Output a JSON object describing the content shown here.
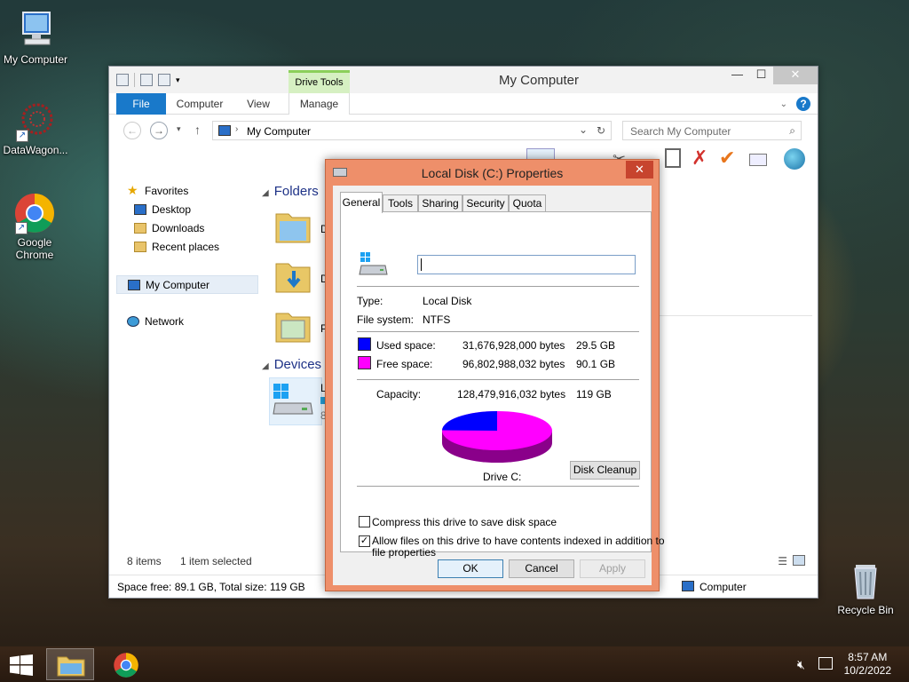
{
  "desktop": {
    "icons": [
      {
        "label": "My Computer"
      },
      {
        "label": "DataWagon..."
      },
      {
        "label": "Google Chrome"
      },
      {
        "label": "Recycle Bin"
      }
    ]
  },
  "explorer": {
    "title": "My Computer",
    "contextual_tab_group": "Drive Tools",
    "tabs": {
      "file": "File",
      "computer": "Computer",
      "view": "View",
      "manage": "Manage"
    },
    "address": "My Computer",
    "search_placeholder": "Search My Computer",
    "nav": {
      "favorites": "Favorites",
      "desktop": "Desktop",
      "downloads": "Downloads",
      "recent": "Recent places",
      "my_computer": "My Computer",
      "network": "Network"
    },
    "groups": {
      "folders": "Folders",
      "devices": "Devices"
    },
    "partial_labels": {
      "folder1": "D",
      "folder2": "D",
      "folder3": "P",
      "device1": "L",
      "device_sub": "8"
    },
    "status": {
      "items": "8 items",
      "selected": "1 item selected",
      "space": "Space free: 89.1 GB, Total size: 119 GB",
      "location": "Computer"
    }
  },
  "dialog": {
    "title": "Local Disk (C:) Properties",
    "tabs": [
      "General",
      "Tools",
      "Sharing",
      "Security",
      "Quota"
    ],
    "name_value": "",
    "type_label": "Type:",
    "type_value": "Local Disk",
    "fs_label": "File system:",
    "fs_value": "NTFS",
    "used": {
      "label": "Used space:",
      "bytes": "31,676,928,000 bytes",
      "size": "29.5 GB",
      "color": "#0000ff"
    },
    "free": {
      "label": "Free space:",
      "bytes": "96,802,988,032 bytes",
      "size": "90.1 GB",
      "color": "#ff00ff"
    },
    "capacity": {
      "label": "Capacity:",
      "bytes": "128,479,916,032 bytes",
      "size": "119 GB"
    },
    "drive_label": "Drive C:",
    "disk_cleanup": "Disk Cleanup",
    "compress_label": "Compress this drive to save disk space",
    "compress_checked": false,
    "index_label_line1": "Allow files on this drive to have contents indexed in addition to",
    "index_label_line2": "file properties",
    "index_checked": true,
    "ok": "OK",
    "cancel": "Cancel",
    "apply": "Apply",
    "used_fraction": 0.2466
  },
  "taskbar": {
    "time": "8:57 AM",
    "date": "10/2/2022"
  }
}
